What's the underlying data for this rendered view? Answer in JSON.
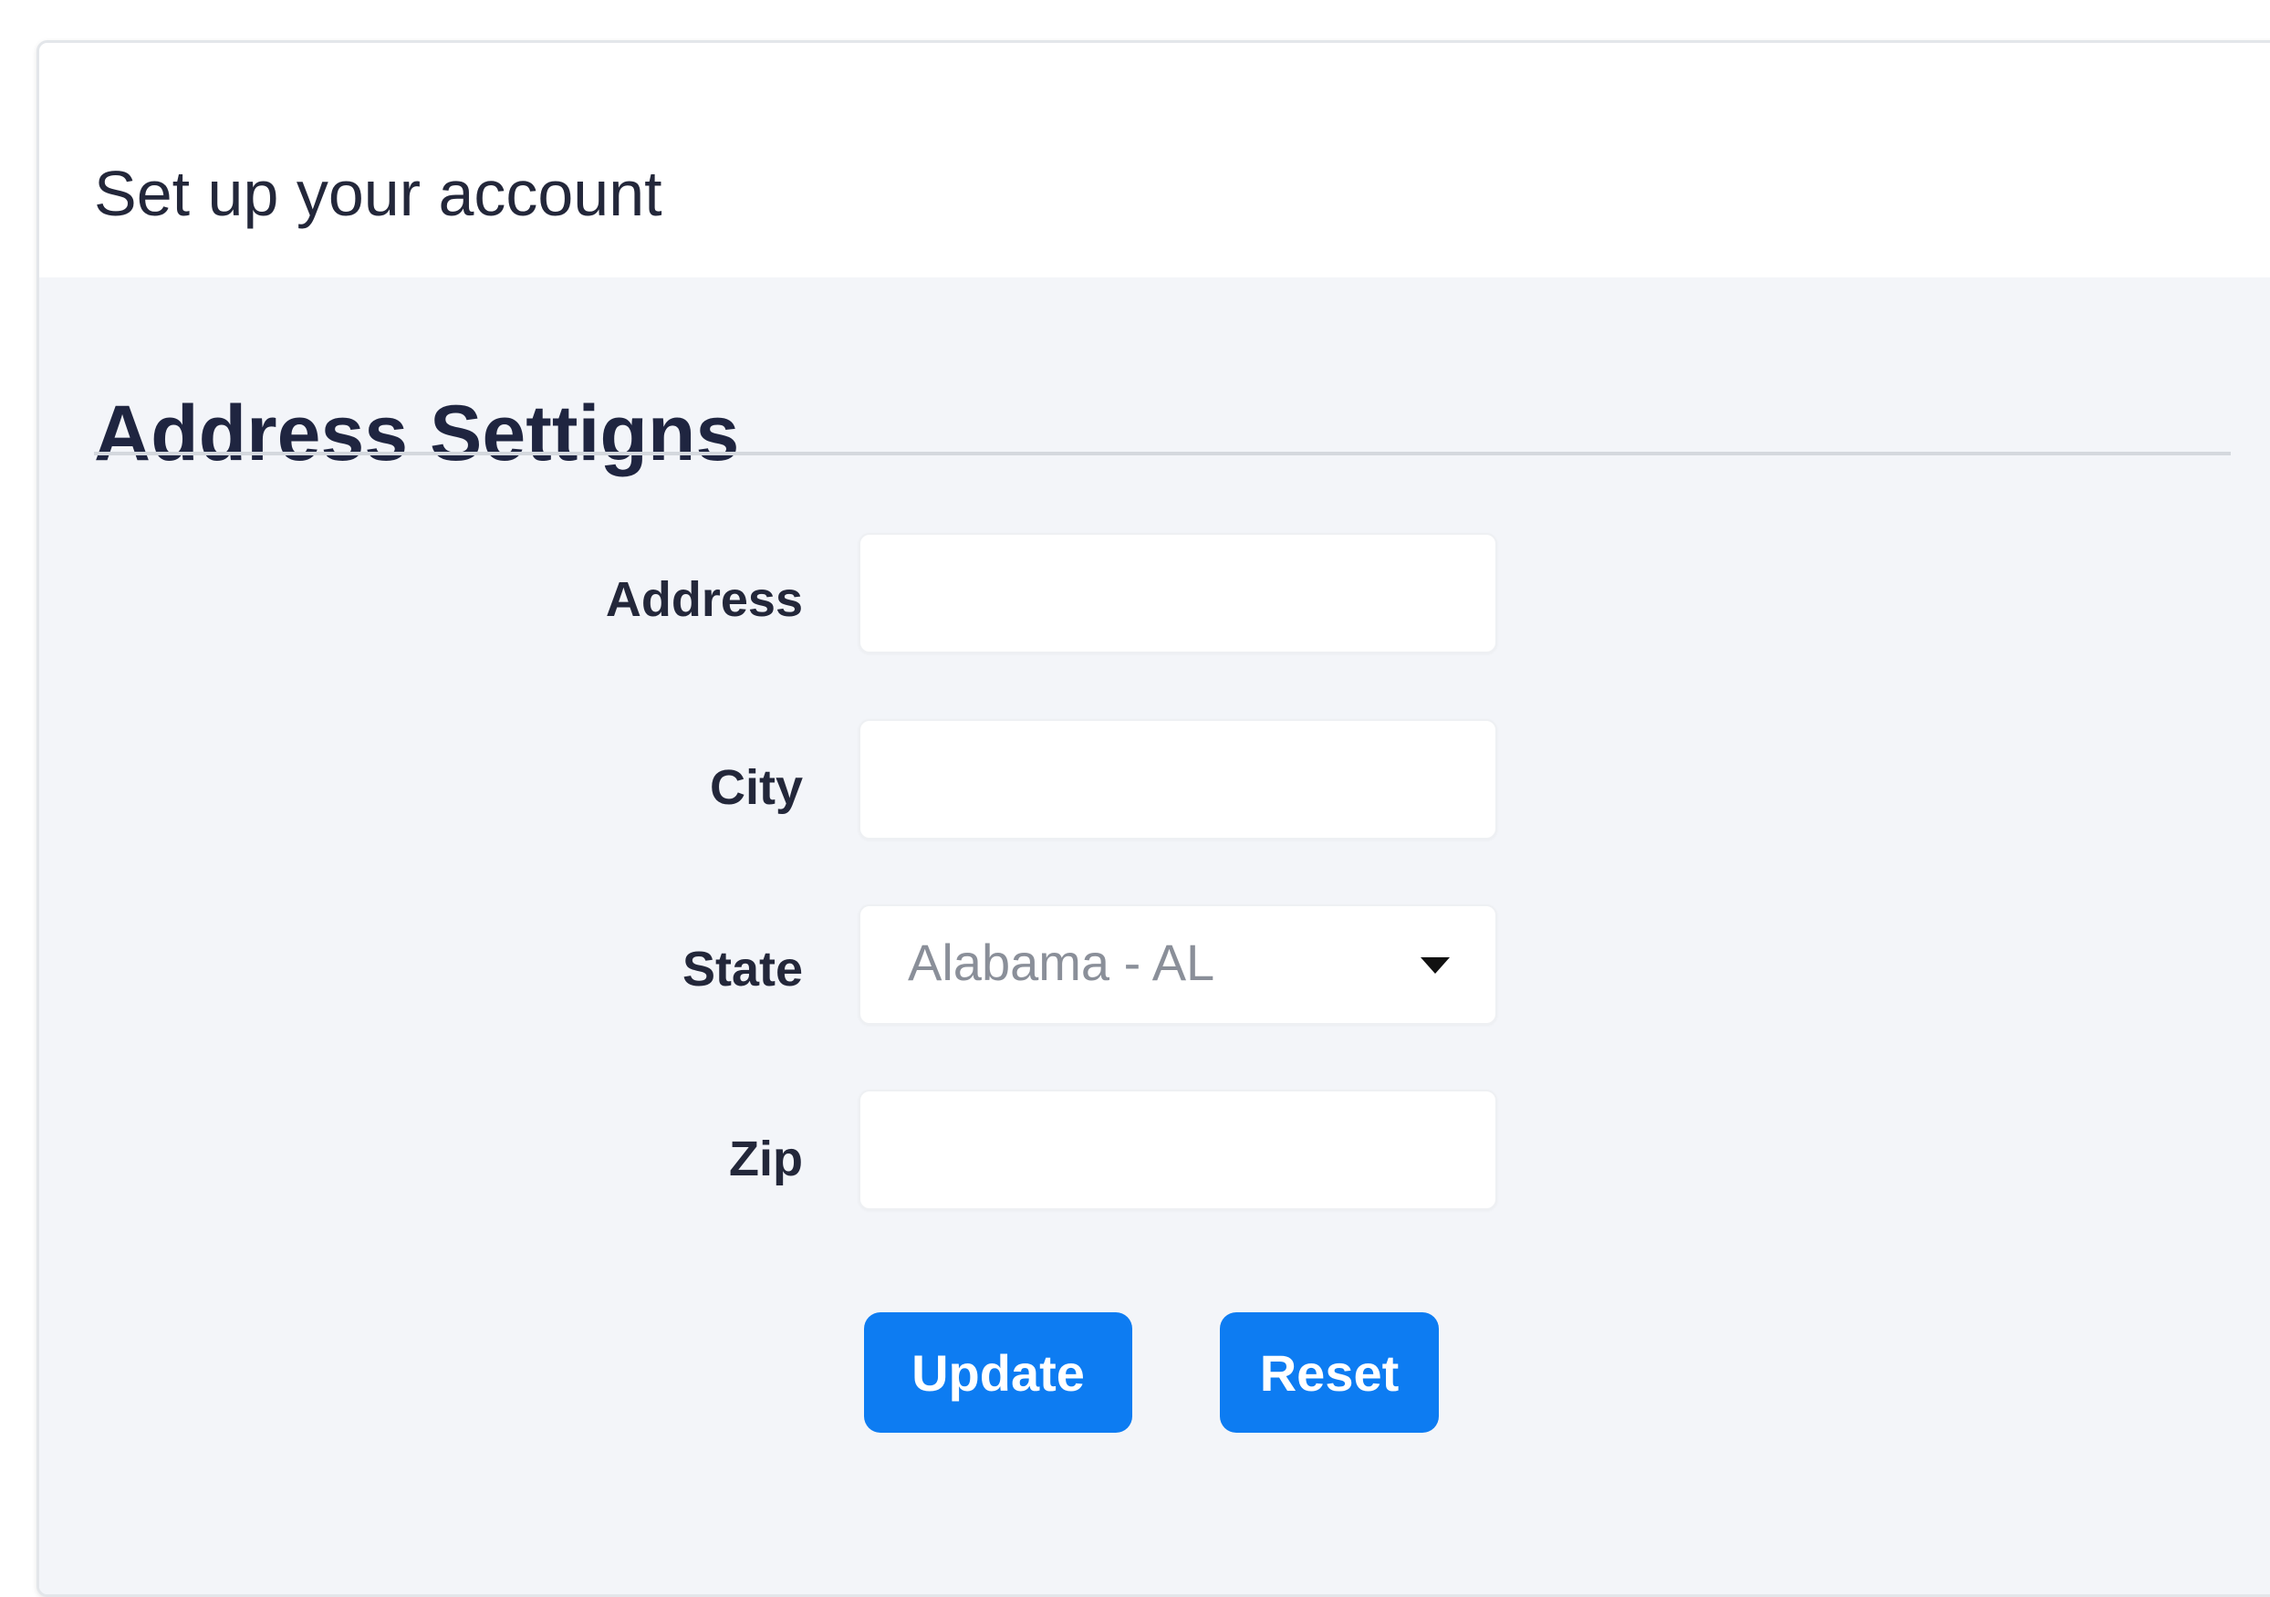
{
  "header": {
    "title": "Set up your account"
  },
  "section": {
    "title": "Address Settigns"
  },
  "form": {
    "address": {
      "label": "Address",
      "value": "",
      "placeholder": ""
    },
    "city": {
      "label": "City",
      "value": "",
      "placeholder": ""
    },
    "state": {
      "label": "State",
      "selected": "Alabama - AL",
      "icon": "caret-down-icon"
    },
    "zip": {
      "label": "Zip",
      "value": "",
      "placeholder": ""
    }
  },
  "actions": {
    "update_label": "Update",
    "reset_label": "Reset"
  },
  "colors": {
    "primary_button": "#0d7cf2",
    "body_background": "#f3f5f9",
    "text_dark": "#1f2540"
  }
}
